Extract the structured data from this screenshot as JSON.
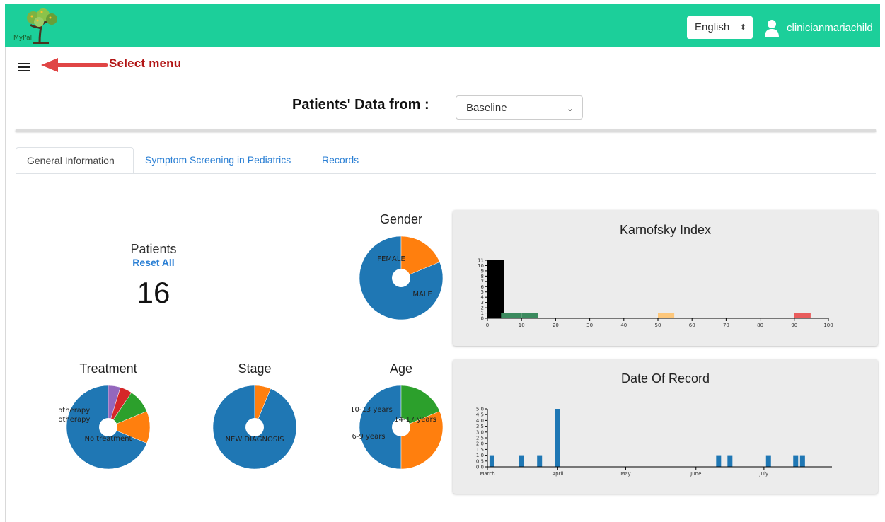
{
  "header": {
    "logo_text": "MyPal",
    "language": "English",
    "username": "clinicianmariachild",
    "bg_color": "#1ccf9a"
  },
  "annotation": {
    "text": "Select menu",
    "color": "#b21515"
  },
  "filter": {
    "label": "Patients' Data from :",
    "selected": "Baseline"
  },
  "tabs": [
    {
      "label": "General Information",
      "active": true
    },
    {
      "label": "Symptom Screening in Pediatrics",
      "active": false
    },
    {
      "label": "Records",
      "active": false
    }
  ],
  "patients": {
    "title": "Patients",
    "reset_label": "Reset All",
    "count": "16"
  },
  "charts": {
    "gender": {
      "title": "Gender"
    },
    "treatment": {
      "title": "Treatment"
    },
    "stage": {
      "title": "Stage"
    },
    "age": {
      "title": "Age"
    },
    "karnofsky": {
      "title": "Karnofsky Index"
    },
    "date_of_record": {
      "title": "Date Of Record"
    }
  },
  "chart_data": [
    {
      "type": "pie",
      "id": "gender",
      "title": "Gender",
      "slices": [
        {
          "label": "MALE",
          "value": 13,
          "color": "#1f77b4"
        },
        {
          "label": "FEMALE",
          "value": 3,
          "color": "#ff7f0e"
        }
      ]
    },
    {
      "type": "pie",
      "id": "treatment",
      "title": "Treatment",
      "slices": [
        {
          "label": "No treatment",
          "value": 11,
          "color": "#1f77b4"
        },
        {
          "label": "chemotherapy",
          "value": 2,
          "color": "#ff7f0e"
        },
        {
          "label": "radiotherapy",
          "value": 1.5,
          "color": "#2ca02c"
        },
        {
          "label": "",
          "value": 0.75,
          "color": "#d62728"
        },
        {
          "label": "",
          "value": 0.75,
          "color": "#9467bd"
        }
      ]
    },
    {
      "type": "pie",
      "id": "stage",
      "title": "Stage",
      "slices": [
        {
          "label": "NEW DIAGNOSIS",
          "value": 15,
          "color": "#1f77b4"
        },
        {
          "label": "",
          "value": 1,
          "color": "#ff7f0e"
        }
      ]
    },
    {
      "type": "pie",
      "id": "age",
      "title": "Age",
      "slices": [
        {
          "label": "14-17 years",
          "value": 8,
          "color": "#1f77b4"
        },
        {
          "label": "6-9 years",
          "value": 5,
          "color": "#ff7f0e"
        },
        {
          "label": "10-13 years",
          "value": 3,
          "color": "#2ca02c"
        }
      ]
    },
    {
      "type": "bar",
      "id": "karnofsky",
      "title": "Karnofsky Index",
      "xlim": [
        0,
        100
      ],
      "ylim": [
        0,
        11
      ],
      "xticks": [
        0,
        10,
        20,
        30,
        40,
        50,
        60,
        70,
        80,
        90,
        100
      ],
      "yticks": [
        0,
        1,
        2,
        3,
        4,
        5,
        6,
        7,
        8,
        9,
        10,
        11
      ],
      "bars": [
        {
          "x0": 0,
          "x1": 5,
          "value": 11,
          "color": "#000000"
        },
        {
          "x0": 4,
          "x1": 10,
          "value": 1,
          "color": "#3b8a5e"
        },
        {
          "x0": 10,
          "x1": 15,
          "value": 1,
          "color": "#3b8a5e"
        },
        {
          "x0": 50,
          "x1": 55,
          "value": 1,
          "color": "#fdc77b"
        },
        {
          "x0": 90,
          "x1": 95,
          "value": 1,
          "color": "#e95d5d"
        }
      ]
    },
    {
      "type": "bar",
      "id": "date_of_record",
      "title": "Date Of Record",
      "xlim": [
        "2021-03-01",
        "2021-07-31"
      ],
      "ylim": [
        0,
        5.0
      ],
      "xticks": [
        {
          "date": "2021-03-01",
          "label": "March"
        },
        {
          "date": "2021-04-01",
          "label": "April"
        },
        {
          "date": "2021-05-01",
          "label": "May"
        },
        {
          "date": "2021-06-01",
          "label": "June"
        },
        {
          "date": "2021-07-01",
          "label": "July"
        }
      ],
      "yticks": [
        "0.0",
        "0.5",
        "1.0",
        "1.5",
        "2.0",
        "2.5",
        "3.0",
        "3.5",
        "4.0",
        "4.5",
        "5.0"
      ],
      "bars": [
        {
          "date": "2021-03-03",
          "value": 1
        },
        {
          "date": "2021-03-16",
          "value": 1
        },
        {
          "date": "2021-03-24",
          "value": 1
        },
        {
          "date": "2021-04-01",
          "value": 5
        },
        {
          "date": "2021-06-11",
          "value": 1
        },
        {
          "date": "2021-06-16",
          "value": 1
        },
        {
          "date": "2021-07-03",
          "value": 1
        },
        {
          "date": "2021-07-15",
          "value": 1
        },
        {
          "date": "2021-07-18",
          "value": 1
        }
      ],
      "color": "#1f77b4"
    }
  ]
}
